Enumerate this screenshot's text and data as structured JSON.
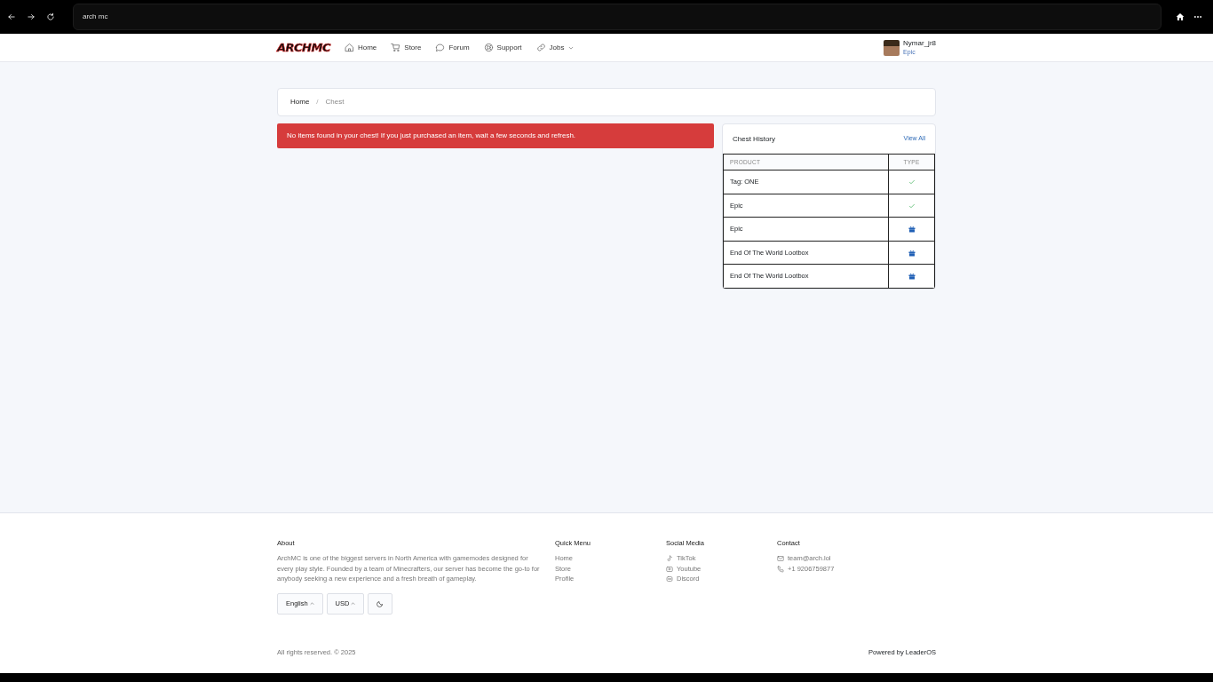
{
  "browser": {
    "address": "arch mc"
  },
  "navbar": {
    "logo": "ARCHMC",
    "items": [
      {
        "kind": "home",
        "label": "Home",
        "dropdown": false
      },
      {
        "kind": "cart",
        "label": "Store",
        "dropdown": false
      },
      {
        "kind": "chat",
        "label": "Forum",
        "dropdown": false
      },
      {
        "kind": "support",
        "label": "Support",
        "dropdown": false
      },
      {
        "kind": "link",
        "label": "Jobs",
        "dropdown": true
      }
    ],
    "user": {
      "name": "Nymar_jr8",
      "rank": "Epic"
    }
  },
  "breadcrumb": [
    {
      "label": "Home",
      "selected": false
    },
    {
      "label": "Chest",
      "selected": true
    }
  ],
  "breadcrumb_separator": "/",
  "alert": "No items found in your chest! If you just purchased an item, wait a few seconds and refresh.",
  "chest_history": {
    "title": "Chest History",
    "link": "View All",
    "columns": [
      "PRODUCT",
      "TYPE"
    ],
    "rows": [
      {
        "product": "Tag: ONE",
        "kind": "check"
      },
      {
        "product": "Epic",
        "kind": "check"
      },
      {
        "product": "Epic",
        "kind": "gift"
      },
      {
        "product": "End Of The World Lootbox",
        "kind": "gift"
      },
      {
        "product": "End Of The World Lootbox",
        "kind": "gift"
      }
    ]
  },
  "footer": {
    "about": {
      "title": "About",
      "text": "ArchMC is one of the biggest servers in North America with gamemodes designed for every play style. Founded by a team of Minecrafters, our server has become the go-to for anybody seeking a new experience and a fresh breath of gameplay."
    },
    "language": "English",
    "currency": "USD",
    "quick_menu": {
      "title": "Quick Menu",
      "links": [
        "Home",
        "Store",
        "Profile"
      ]
    },
    "social": {
      "title": "Social Media",
      "links": [
        {
          "kind": "tiktok",
          "label": "TikTok"
        },
        {
          "kind": "video",
          "label": "Youtube"
        },
        {
          "kind": "discord",
          "label": "Discord"
        }
      ]
    },
    "contact": {
      "title": "Contact",
      "items": [
        {
          "kind": "mail",
          "label": "team@arch.lol"
        },
        {
          "kind": "phone",
          "label": "+1 9206759877"
        }
      ]
    },
    "copyright": "All rights reserved. © 2025",
    "powered": "Powered by LeaderOS"
  }
}
